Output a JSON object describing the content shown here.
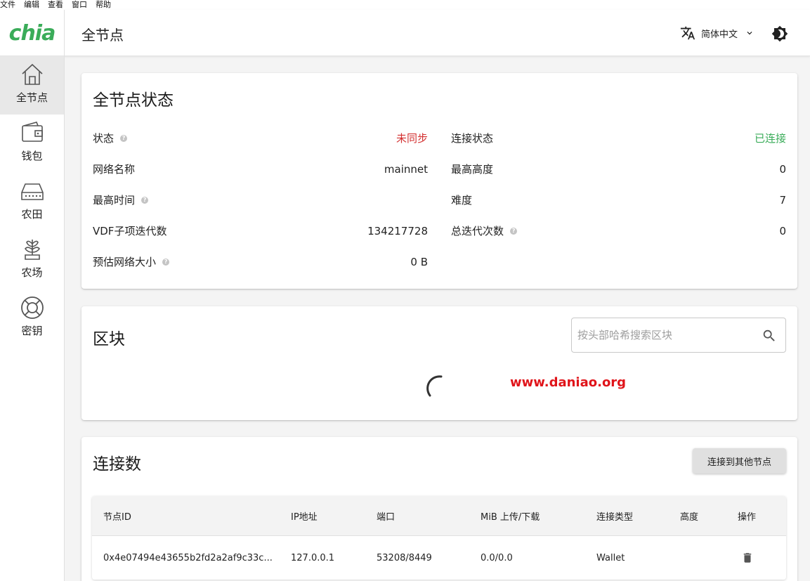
{
  "menubar": [
    "文件",
    "编辑",
    "查看",
    "窗口",
    "帮助"
  ],
  "logo": "chia",
  "header": {
    "title": "全节点",
    "language": "简体中文"
  },
  "sidebar": {
    "items": [
      {
        "label": "全节点",
        "icon": "home-icon",
        "active": true
      },
      {
        "label": "钱包",
        "icon": "wallet-icon",
        "active": false
      },
      {
        "label": "农田",
        "icon": "harddrive-icon",
        "active": false
      },
      {
        "label": "农场",
        "icon": "plant-icon",
        "active": false
      },
      {
        "label": "密钥",
        "icon": "lifebuoy-icon",
        "active": false
      }
    ]
  },
  "status": {
    "title": "全节点状态",
    "left": [
      {
        "key": "状态",
        "value": "未同步",
        "help": true
      },
      {
        "key": "网络名称",
        "value": "mainnet",
        "help": false
      },
      {
        "key": "最高时间",
        "value": "",
        "help": true
      },
      {
        "key": "VDF子项迭代数",
        "value": "134217728",
        "help": false
      },
      {
        "key": "预估网络大小",
        "value": "0 B",
        "help": true
      }
    ],
    "right": [
      {
        "key": "连接状态",
        "value": "已连接",
        "help": false
      },
      {
        "key": "最高高度",
        "value": "0",
        "help": false
      },
      {
        "key": "难度",
        "value": "7",
        "help": false
      },
      {
        "key": "总迭代次数",
        "value": "0",
        "help": true
      }
    ]
  },
  "blocks": {
    "title": "区块",
    "search_placeholder": "按头部哈希搜索区块",
    "watermark": "www.daniao.org"
  },
  "connections": {
    "title": "连接数",
    "button": "连接到其他节点",
    "columns": [
      "节点ID",
      "IP地址",
      "端口",
      "MiB 上传/下载",
      "连接类型",
      "高度",
      "操作"
    ],
    "rows": [
      {
        "node_id": "0x4e07494e43655b2fd2a2af9c33c...",
        "ip": "127.0.0.1",
        "port": "53208/8449",
        "mib": "0.0/0.0",
        "type": "Wallet",
        "height": ""
      }
    ]
  },
  "colors": {
    "brand": "#3aac59",
    "error": "#d32f2f",
    "success": "#3aac59"
  }
}
